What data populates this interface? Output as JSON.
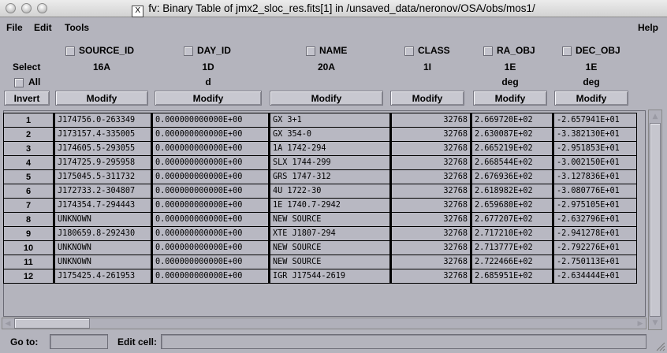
{
  "window": {
    "title": "fv: Binary Table of jmx2_sloc_res.fits[1] in /unsaved_data/neronov/OSA/obs/mos1/",
    "x_glyph": "X"
  },
  "menu": {
    "file": "File",
    "edit": "Edit",
    "tools": "Tools",
    "help": "Help"
  },
  "controls": {
    "select_label": "Select",
    "all_label": "All",
    "invert_label": "Invert",
    "modify_label": "Modify"
  },
  "columns": [
    {
      "name": "SOURCE_ID",
      "format": "16A",
      "unit": ""
    },
    {
      "name": "DAY_ID",
      "format": "1D",
      "unit": "d"
    },
    {
      "name": "NAME",
      "format": "20A",
      "unit": ""
    },
    {
      "name": "CLASS",
      "format": "1I",
      "unit": ""
    },
    {
      "name": "RA_OBJ",
      "format": "1E",
      "unit": "deg"
    },
    {
      "name": "DEC_OBJ",
      "format": "1E",
      "unit": "deg"
    }
  ],
  "rows": [
    {
      "n": "1",
      "source_id": "J174756.0-263349",
      "day_id": "0.000000000000E+00",
      "name": "GX 3+1",
      "class": "32768",
      "ra": "2.669720E+02",
      "dec": "-2.657941E+01"
    },
    {
      "n": "2",
      "source_id": "J173157.4-335005",
      "day_id": "0.000000000000E+00",
      "name": "GX 354-0",
      "class": "32768",
      "ra": "2.630087E+02",
      "dec": "-3.382130E+01"
    },
    {
      "n": "3",
      "source_id": "J174605.5-293055",
      "day_id": "0.000000000000E+00",
      "name": "1A 1742-294",
      "class": "32768",
      "ra": "2.665219E+02",
      "dec": "-2.951853E+01"
    },
    {
      "n": "4",
      "source_id": "J174725.9-295958",
      "day_id": "0.000000000000E+00",
      "name": "SLX 1744-299",
      "class": "32768",
      "ra": "2.668544E+02",
      "dec": "-3.002150E+01"
    },
    {
      "n": "5",
      "source_id": "J175045.5-311732",
      "day_id": "0.000000000000E+00",
      "name": "GRS 1747-312",
      "class": "32768",
      "ra": "2.676936E+02",
      "dec": "-3.127836E+01"
    },
    {
      "n": "6",
      "source_id": "J172733.2-304807",
      "day_id": "0.000000000000E+00",
      "name": "4U 1722-30",
      "class": "32768",
      "ra": "2.618982E+02",
      "dec": "-3.080776E+01"
    },
    {
      "n": "7",
      "source_id": "J174354.7-294443",
      "day_id": "0.000000000000E+00",
      "name": "1E 1740.7-2942",
      "class": "32768",
      "ra": "2.659680E+02",
      "dec": "-2.975105E+01"
    },
    {
      "n": "8",
      "source_id": "UNKNOWN",
      "day_id": "0.000000000000E+00",
      "name": "NEW SOURCE",
      "class": "32768",
      "ra": "2.677207E+02",
      "dec": "-2.632796E+01"
    },
    {
      "n": "9",
      "source_id": "J180659.8-292430",
      "day_id": "0.000000000000E+00",
      "name": "XTE J1807-294",
      "class": "32768",
      "ra": "2.717210E+02",
      "dec": "-2.941278E+01"
    },
    {
      "n": "10",
      "source_id": "UNKNOWN",
      "day_id": "0.000000000000E+00",
      "name": "NEW SOURCE",
      "class": "32768",
      "ra": "2.713777E+02",
      "dec": "-2.792276E+01"
    },
    {
      "n": "11",
      "source_id": "UNKNOWN",
      "day_id": "0.000000000000E+00",
      "name": "NEW SOURCE",
      "class": "32768",
      "ra": "2.722466E+02",
      "dec": "-2.750113E+01"
    },
    {
      "n": "12",
      "source_id": "J175425.4-261953",
      "day_id": "0.000000000000E+00",
      "name": "IGR J17544-2619",
      "class": "32768",
      "ra": "2.685951E+02",
      "dec": "-2.634444E+01"
    }
  ],
  "statusbar": {
    "goto_label": "Go to:",
    "goto_value": "",
    "editcell_label": "Edit cell:",
    "editcell_value": ""
  }
}
